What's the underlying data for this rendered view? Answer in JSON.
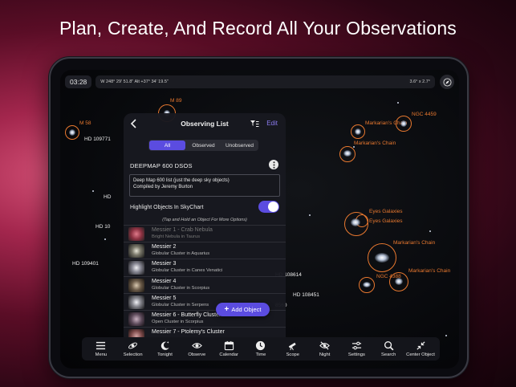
{
  "hero": {
    "title": "Plan, Create, And Record All Your Observations"
  },
  "topbar": {
    "time": "03:28",
    "coords": "W 248° 29' 51.8\" Alt +37° 34' 19.5\"",
    "fov": "3.6° x 2.7°"
  },
  "sky": {
    "labels": {
      "m89": "M 89",
      "m58": "M 58",
      "hd109771": "HD 109771",
      "hd_a": "HD",
      "hd_b": "HD 10",
      "hd109401": "HD 109401",
      "hd108614": "HD 108614",
      "hd108451": "HD 108451",
      "n8560": "8560",
      "markarian1": "Markarian's Chain",
      "markarian2": "Markarian's Chain",
      "markarian3": "Markarian's Chain",
      "markarian4": "Markarian's Chain",
      "ngc4459": "NGC 4459",
      "eyes1": "Eyes Galaxies",
      "eyes2": "Eyes Galaxies",
      "ngc4388": "NGC 4388"
    }
  },
  "panel": {
    "title": "Observing List",
    "edit": "Edit",
    "segments": [
      "All",
      "Observed",
      "Unobserved"
    ],
    "list_name": "DEEPMAP 600 DSOS",
    "description_line1": "Deep Map 600 list (just the deep sky objects)",
    "description_line2": "Compiled by Jeremy Burton",
    "highlight_label": "Highlight Objects In SkyChart",
    "highlight_on": true,
    "hint": "(Tap and Hold an Object For More Options)",
    "objects": [
      {
        "name": "Messier 1 - Crab Nebula",
        "sub": "Bright Nebula in Taurus",
        "thumb": "#b04a5a"
      },
      {
        "name": "Messier 2",
        "sub": "Globular Cluster in Aquarius",
        "thumb": "#8a8a7a"
      },
      {
        "name": "Messier 3",
        "sub": "Globular Cluster in Canes Venatici",
        "thumb": "#9a9aa0"
      },
      {
        "name": "Messier 4",
        "sub": "Globular Cluster in Scorpius",
        "thumb": "#7a6a5a"
      },
      {
        "name": "Messier 5",
        "sub": "Globular Cluster in Serpens",
        "thumb": "#8a8a90"
      },
      {
        "name": "Messier 6 - Butterfly Cluster",
        "sub": "Open Cluster in Scorpius",
        "thumb": "#6a5a6a"
      },
      {
        "name": "Messier 7 - Ptolemy's Cluster",
        "sub": "",
        "thumb": "#8a5a5a"
      }
    ],
    "add_button": "Add Object"
  },
  "toolbar": {
    "items": [
      {
        "label": "Menu",
        "icon": "menu-icon"
      },
      {
        "label": "Selection",
        "icon": "selection-icon"
      },
      {
        "label": "Tonight",
        "icon": "tonight-icon"
      },
      {
        "label": "Observe",
        "icon": "observe-icon"
      },
      {
        "label": "Calendar",
        "icon": "calendar-icon"
      },
      {
        "label": "Time",
        "icon": "time-icon"
      },
      {
        "label": "Scope",
        "icon": "scope-icon"
      },
      {
        "label": "Night",
        "icon": "night-icon"
      },
      {
        "label": "Settings",
        "icon": "settings-icon"
      },
      {
        "label": "Search",
        "icon": "search-icon"
      },
      {
        "label": "Center Object",
        "icon": "center-object-icon"
      }
    ]
  },
  "colors": {
    "accent": "#5b4ce0",
    "orange_label": "#e8782f",
    "edit_link": "#8c7cf0"
  }
}
